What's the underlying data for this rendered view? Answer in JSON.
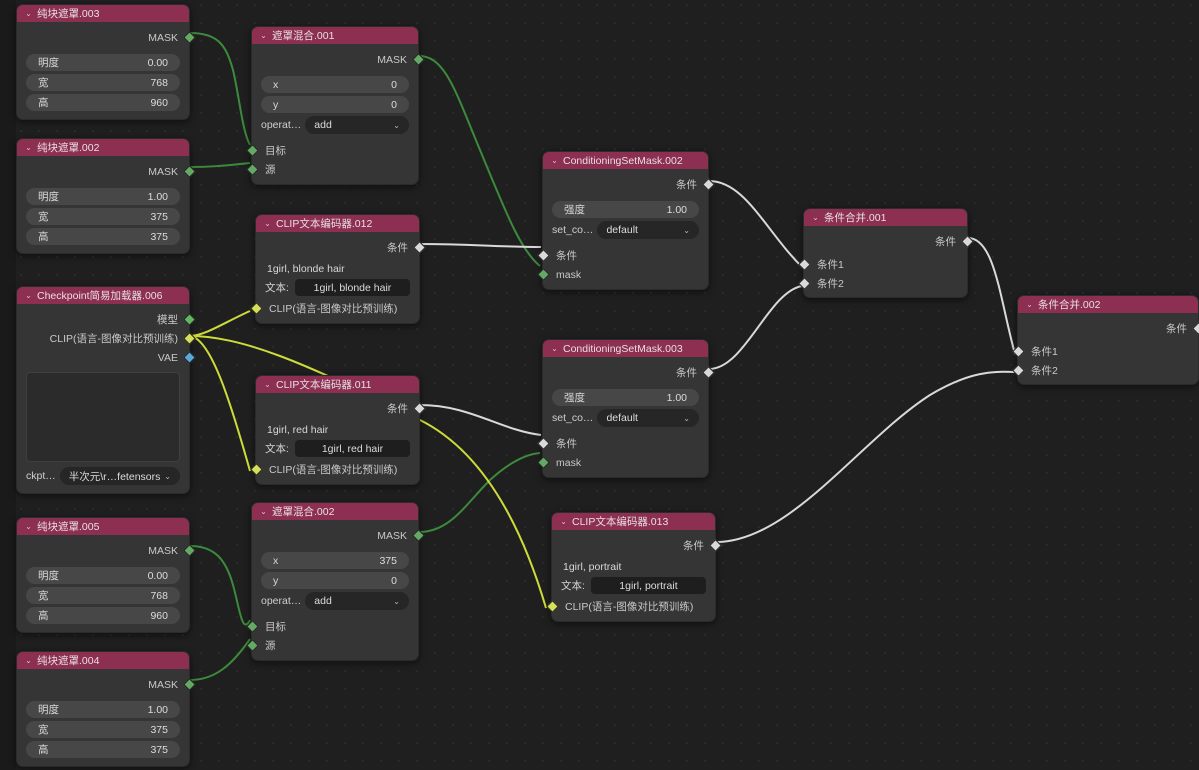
{
  "app": {
    "name": "ComfyUI Node Graph",
    "background": "#1f1f1f"
  },
  "colors": {
    "node_title": "#8d2f51",
    "node_body": "#353535",
    "link_mask": "#3c8a3c",
    "link_cond": "#d9d9d9",
    "link_clip": "#cddc39"
  },
  "labels": {
    "mask_out": "MASK",
    "cond_out": "条件",
    "target_in": "目标",
    "source_in": "源",
    "cond_in": "条件",
    "mask_in": "mask",
    "clip_in": "CLIP(语言-图像对比预训练)",
    "model_out": "模型",
    "clip_out": "CLIP(语言-图像对比预训练)",
    "vae_out": "VAE",
    "cond1_in": "条件1",
    "cond2_in": "条件2",
    "chevron": "⌄",
    "combo_arrow": "⌄"
  },
  "nodes": {
    "solid_mask_003": {
      "title": "纯块遮罩.003",
      "output": "MASK",
      "widgets": [
        {
          "label": "明度",
          "value": "0.00"
        },
        {
          "label": "宽",
          "value": "768"
        },
        {
          "label": "高",
          "value": "960"
        }
      ]
    },
    "solid_mask_002": {
      "title": "纯块遮罩.002",
      "output": "MASK",
      "widgets": [
        {
          "label": "明度",
          "value": "1.00"
        },
        {
          "label": "宽",
          "value": "375"
        },
        {
          "label": "高",
          "value": "375"
        }
      ]
    },
    "solid_mask_005": {
      "title": "纯块遮罩.005",
      "output": "MASK",
      "widgets": [
        {
          "label": "明度",
          "value": "0.00"
        },
        {
          "label": "宽",
          "value": "768"
        },
        {
          "label": "高",
          "value": "960"
        }
      ]
    },
    "solid_mask_004": {
      "title": "纯块遮罩.004",
      "output": "MASK",
      "widgets": [
        {
          "label": "明度",
          "value": "1.00"
        },
        {
          "label": "宽",
          "value": "375"
        },
        {
          "label": "高",
          "value": "375"
        }
      ]
    },
    "mask_composite_001": {
      "title": "遮罩混合.001",
      "output": "MASK",
      "widgets": [
        {
          "label": "x",
          "value": "0"
        },
        {
          "label": "y",
          "value": "0"
        }
      ],
      "combo": {
        "label": "operat…",
        "value": "add"
      },
      "inputs": [
        "目标",
        "源"
      ]
    },
    "mask_composite_002": {
      "title": "遮罩混合.002",
      "output": "MASK",
      "widgets": [
        {
          "label": "x",
          "value": "375"
        },
        {
          "label": "y",
          "value": "0"
        }
      ],
      "combo": {
        "label": "operat…",
        "value": "add"
      },
      "inputs": [
        "目标",
        "源"
      ]
    },
    "clip_encode_012": {
      "title": "CLIP文本编码器.012",
      "output": "条件",
      "preview_text": "1girl, blonde hair",
      "text_label": "文本:",
      "text_value": "1girl, blonde hair",
      "clip_input": "CLIP(语言-图像对比预训练)"
    },
    "clip_encode_011": {
      "title": "CLIP文本编码器.011",
      "output": "条件",
      "preview_text": "1girl, red hair",
      "text_label": "文本:",
      "text_value": "1girl, red hair",
      "clip_input": "CLIP(语言-图像对比预训练)"
    },
    "clip_encode_013": {
      "title": "CLIP文本编码器.013",
      "output": "条件",
      "preview_text": "1girl, portrait",
      "text_label": "文本:",
      "text_value": "1girl, portrait",
      "clip_input": "CLIP(语言-图像对比预训练)"
    },
    "checkpoint_loader_006": {
      "title": "Checkpoint简易加载器.006",
      "outputs": [
        "模型",
        "CLIP(语言-图像对比预训练)",
        "VAE"
      ],
      "combo": {
        "label": "ckpt…",
        "value": "半次元\\r…fetensors"
      }
    },
    "cond_set_mask_002": {
      "title": "ConditioningSetMask.002",
      "output": "条件",
      "widgets": [
        {
          "label": "强度",
          "value": "1.00"
        }
      ],
      "combo": {
        "label": "set_co…",
        "value": "default"
      },
      "inputs": [
        "条件",
        "mask"
      ]
    },
    "cond_set_mask_003": {
      "title": "ConditioningSetMask.003",
      "output": "条件",
      "widgets": [
        {
          "label": "强度",
          "value": "1.00"
        }
      ],
      "combo": {
        "label": "set_co…",
        "value": "default"
      },
      "inputs": [
        "条件",
        "mask"
      ]
    },
    "cond_combine_001": {
      "title": "条件合并.001",
      "output": "条件",
      "inputs": [
        "条件1",
        "条件2"
      ]
    },
    "cond_combine_002": {
      "title": "条件合并.002",
      "output": "条件",
      "inputs": [
        "条件1",
        "条件2"
      ]
    }
  }
}
